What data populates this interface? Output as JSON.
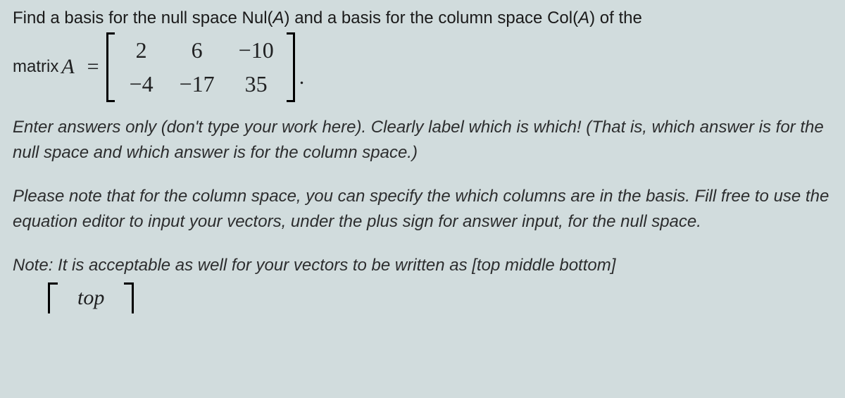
{
  "problem": {
    "line1_pre": "Find a basis for the null space Nul(",
    "line1_A1": "A",
    "line1_mid": ") and a basis for the column space Col(",
    "line1_A2": "A",
    "line1_post": ") of the",
    "matrix_label": "matrix",
    "matrix_var": "A",
    "equals": "=",
    "matrix": {
      "r1c1": "2",
      "r1c2": "6",
      "r1c3": "−10",
      "r2c1": "−4",
      "r2c2": "−17",
      "r2c3": "35"
    },
    "period": "."
  },
  "instr1": "Enter answers only (don't type your work here). Clearly label which is which! (That is, which answer is for the null space and which answer is for the column space.)",
  "instr2": "Please note that for the column space, you can specify the which columns are in the basis. Fill free to use the equation editor to input your vectors, under the plus sign for answer input, for the null space.",
  "note": "Note: It is acceptable as well for your vectors to be written as [top middle bottom]",
  "top_word": "top"
}
